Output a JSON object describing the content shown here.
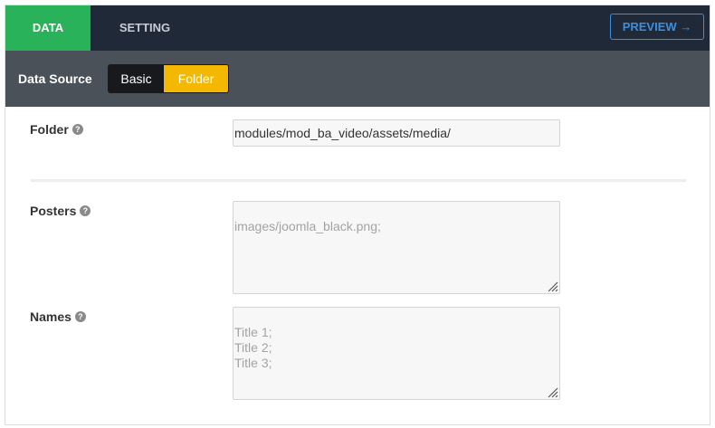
{
  "tabs": {
    "data_label": "DATA",
    "setting_label": "SETTING",
    "preview_label": "PREVIEW →"
  },
  "source_bar": {
    "label": "Data Source",
    "options": [
      "Basic",
      "Folder"
    ],
    "selected": "Folder"
  },
  "fields": {
    "folder": {
      "label": "Folder",
      "value": "modules/mod_ba_video/assets/media/"
    },
    "posters": {
      "label": "Posters",
      "placeholder": "images/joomla_black.png;"
    },
    "names": {
      "label": "Names",
      "placeholder": "Title 1;\nTitle 2;\nTitle 3;"
    }
  },
  "help_glyph": "?",
  "colors": {
    "topbar": "#1f2937",
    "active_tab": "#2ab25a",
    "preview_accent": "#3b8fe0",
    "source_bar": "#4b5158",
    "folder_active": "#f5b800"
  }
}
